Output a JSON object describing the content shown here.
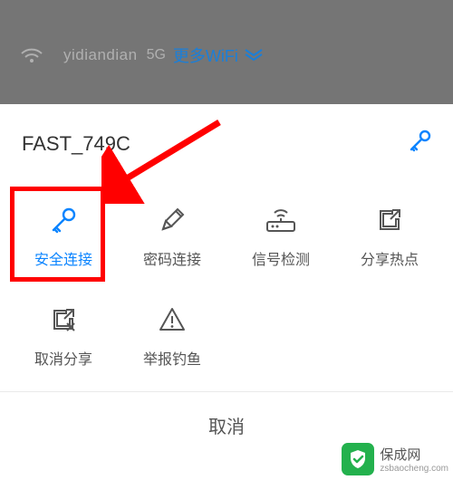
{
  "backdrop": {
    "ssid": "yidiandian",
    "band": "5G",
    "more_wifi": "更多WiFi"
  },
  "sheet": {
    "title": "FAST_749C"
  },
  "tiles": [
    {
      "label": "安全连接",
      "icon": "key-icon",
      "active": true
    },
    {
      "label": "密码连接",
      "icon": "pencil-icon",
      "active": false
    },
    {
      "label": "信号检测",
      "icon": "router-icon",
      "active": false
    },
    {
      "label": "分享热点",
      "icon": "share-out-icon",
      "active": false
    },
    {
      "label": "取消分享",
      "icon": "share-cancel-icon",
      "active": false
    },
    {
      "label": "举报钓鱼",
      "icon": "warning-icon",
      "active": false
    }
  ],
  "cancel": "取消",
  "watermark": "保成网",
  "watermark_domain": "zsbaocheng.com"
}
